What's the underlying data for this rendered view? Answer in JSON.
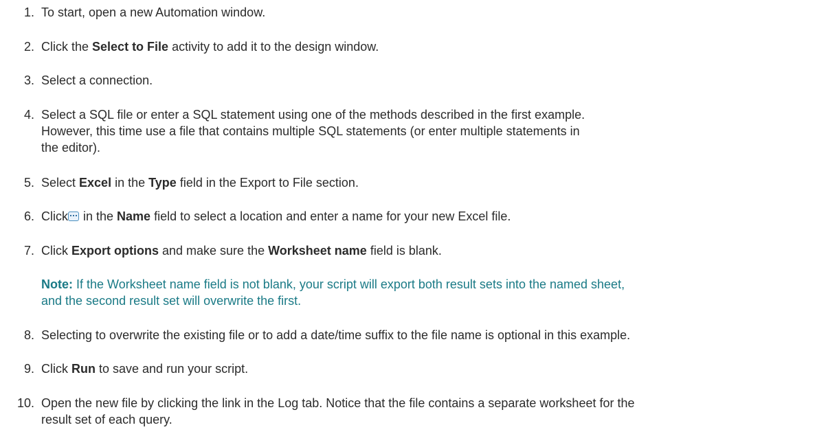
{
  "steps": [
    {
      "num": "1.",
      "parts": [
        "To start, open a new Automation window."
      ]
    },
    {
      "num": "2.",
      "parts": [
        "Click the ",
        "Select to File",
        " activity to add it to the design window."
      ]
    },
    {
      "num": "3.",
      "parts": [
        "Select a connection."
      ]
    },
    {
      "num": "4.",
      "lines": [
        "Select a SQL file or enter a SQL statement using one of the methods described in the first example.",
        "However, this time use a file that contains multiple SQL statements (or enter multiple statements in",
        "the editor)."
      ]
    },
    {
      "num": "5.",
      "parts": [
        "Select ",
        "Excel",
        " in the ",
        "Type",
        " field in the Export to File section."
      ]
    },
    {
      "num": "6.",
      "parts": [
        "Click",
        "",
        " in the ",
        "Name",
        " field to select a location and enter a name for your new Excel file."
      ],
      "icon": "ellipsis-browse-icon"
    },
    {
      "num": "7.",
      "parts": [
        "Click ",
        "Export options",
        " and make sure the ",
        "Worksheet name",
        " field is blank."
      ]
    },
    {
      "num": "8.",
      "parts": [
        "Selecting to overwrite the existing file or to add a date/time suffix to the file name is optional in this example."
      ]
    },
    {
      "num": "9.",
      "parts": [
        "Click ",
        "Run",
        " to save and run your script."
      ]
    },
    {
      "num": "10.",
      "lines": [
        "Open the new file by clicking the link in the Log tab. Notice that the file contains a separate worksheet for the",
        "result set of each query."
      ]
    }
  ],
  "note": {
    "label": "Note:",
    "lines": [
      " If the Worksheet name field is not blank, your script will export both result sets into the named sheet,",
      "and the second result set will overwrite the first."
    ]
  },
  "colors": {
    "text": "#2b2b2b",
    "note": "#1a7a86",
    "icon_border": "#4a8fbf"
  }
}
